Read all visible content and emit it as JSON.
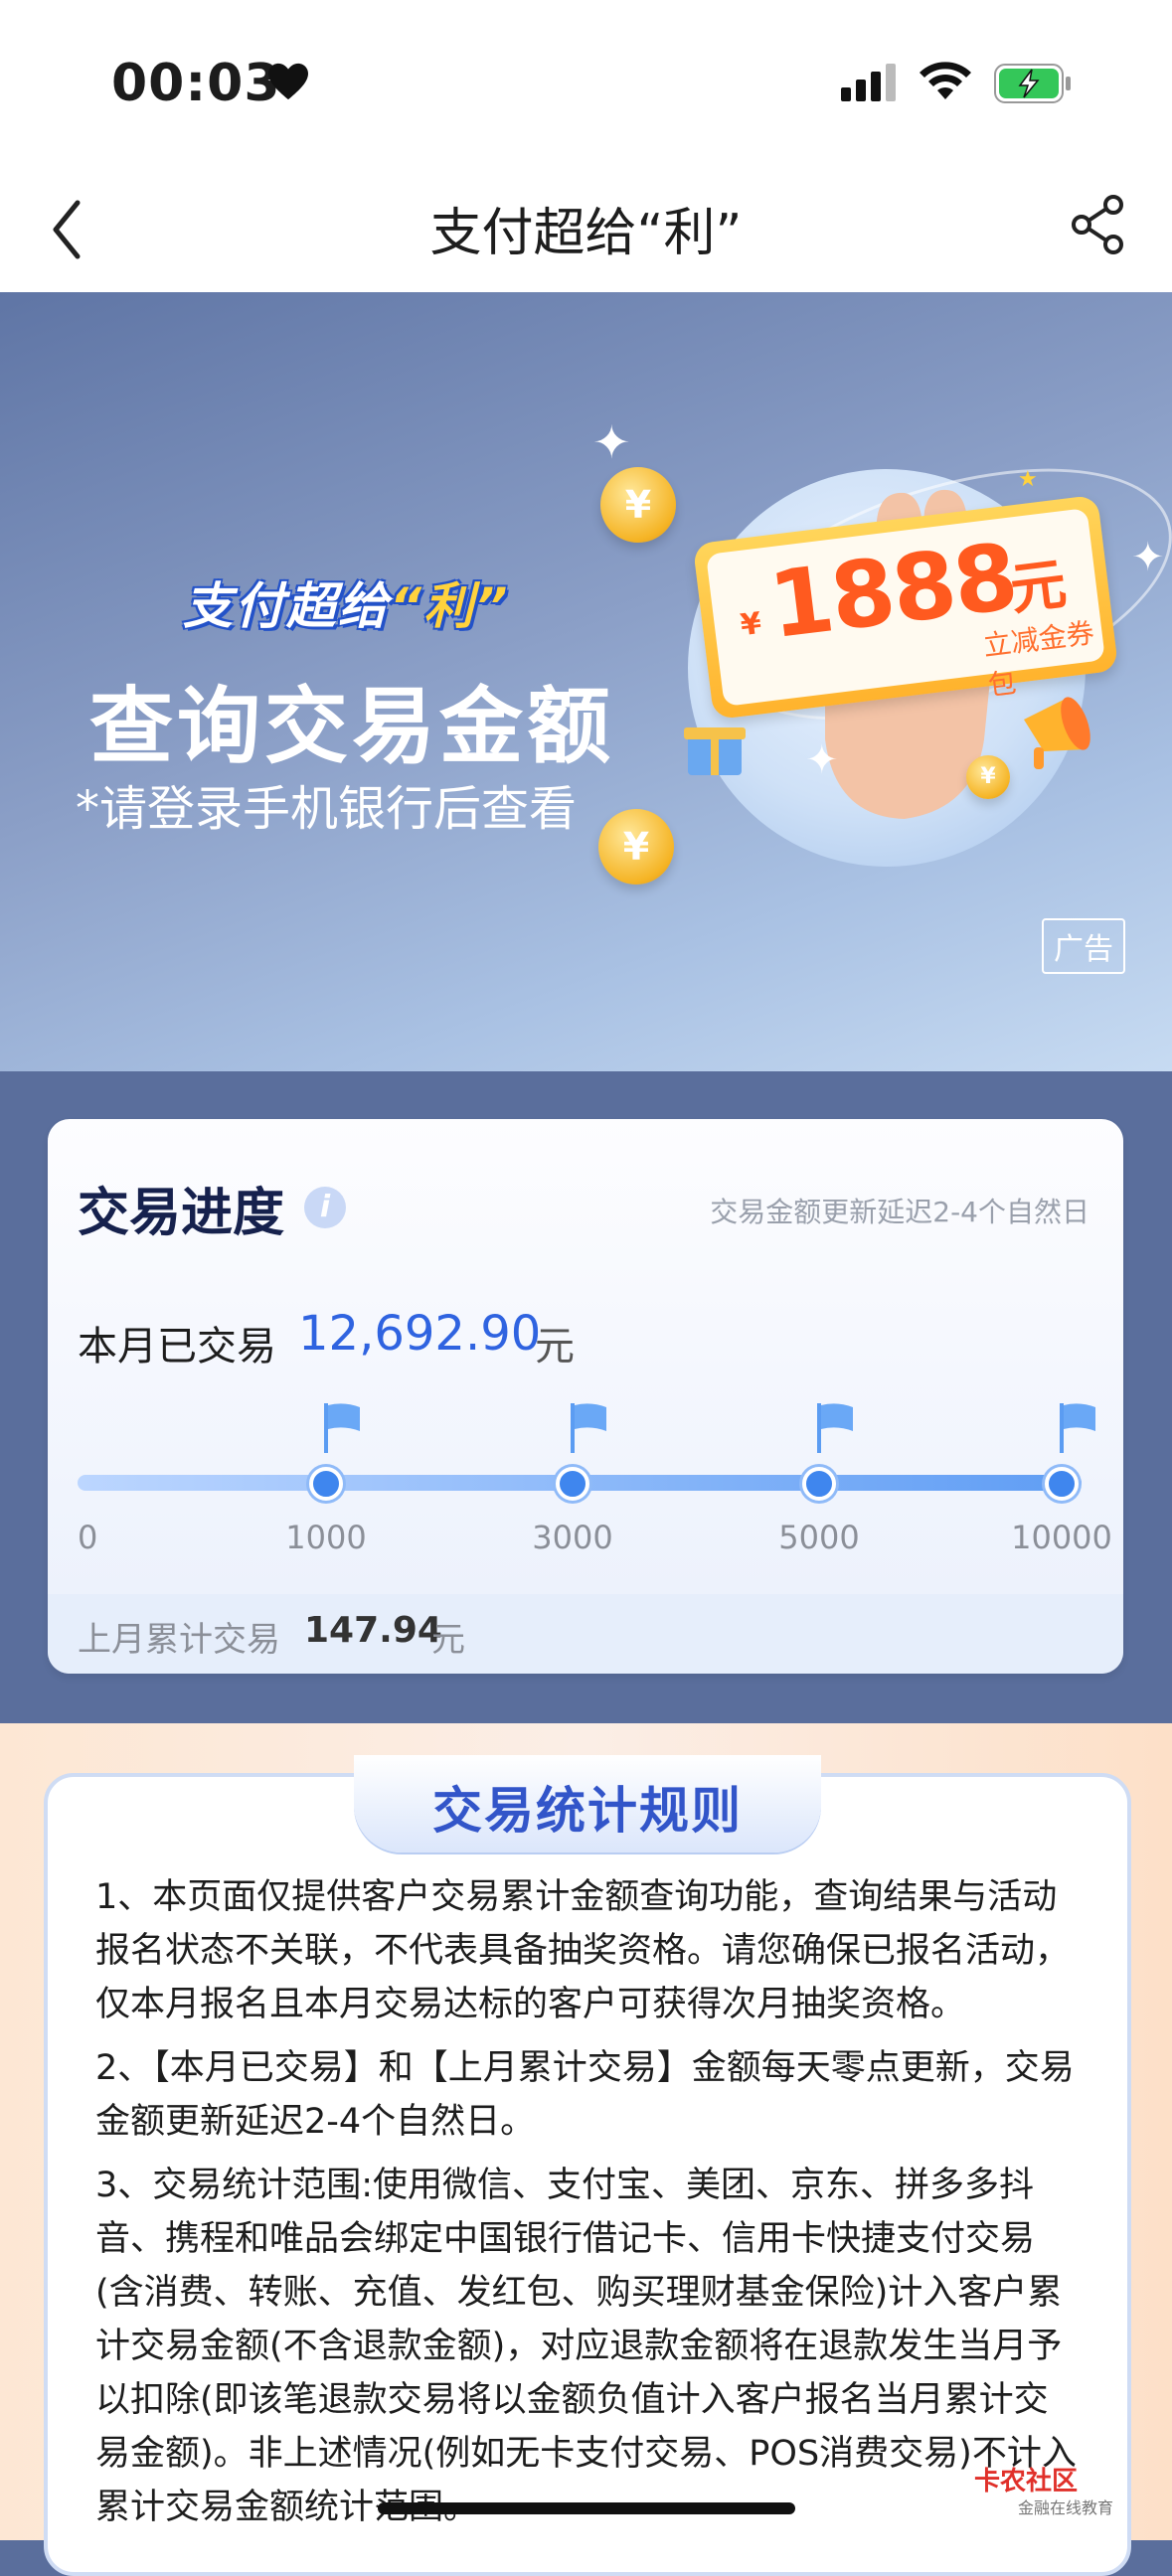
{
  "status_bar": {
    "time": "00:03"
  },
  "nav": {
    "title": "支付超给“利”"
  },
  "banner": {
    "brand_prefix": "支付超给",
    "brand_accent": "“利”",
    "headline": "查询交易金额",
    "subline": "*请登录手机银行后查看",
    "coupon_currency": "¥",
    "coupon_amount": "1888",
    "coupon_unit": "元",
    "coupon_sub": "立减金券包",
    "coin_symbol": "¥",
    "ad_tag": "广告"
  },
  "progress": {
    "title": "交易进度",
    "info_icon": "i",
    "delay_note": "交易金额更新延迟2-4个自然日",
    "month_label": "本月已交易",
    "month_value": "12,692.90",
    "month_unit": "元",
    "milestones": [
      "0",
      "1000",
      "3000",
      "5000",
      "10000"
    ],
    "fill_fraction": 1.0,
    "last_label": "上月累计交易",
    "last_value": "147.94",
    "last_unit": "元"
  },
  "rules": {
    "title": "交易统计规则",
    "items": [
      "1、本页面仅提供客户交易累计金额查询功能，查询结果与活动报名状态不关联，不代表具备抽奖资格。请您确保已报名活动，仅本月报名且本月交易达标的客户可获得次月抽奖资格。",
      "2、【本月已交易】和【上月累计交易】金额每天零点更新，交易金额更新延迟2-4个自然日。",
      "3、交易统计范围:使用微信、支付宝、美团、京东、拼多多抖音、携程和唯品会绑定中国银行借记卡、信用卡快捷支付交易(含消费、转账、充值、发红包、购买理财基金保险)计入客户累计交易金额(不含退款金额)，对应退款金额将在退款发生当月予以扣除(即该笔退款交易将以金额负值计入客户报名当月累计交易金额)。非上述情况(例如无卡支付交易、POS消费交易)不计入累计交易金额统计范围。"
    ]
  },
  "watermark": {
    "name": "卡农社区",
    "sub": "金融在线教育"
  },
  "colors": {
    "accent_blue": "#2f63e0",
    "coupon_orange": "#ff5a1f",
    "progress_bg": "#5a6e9c"
  }
}
